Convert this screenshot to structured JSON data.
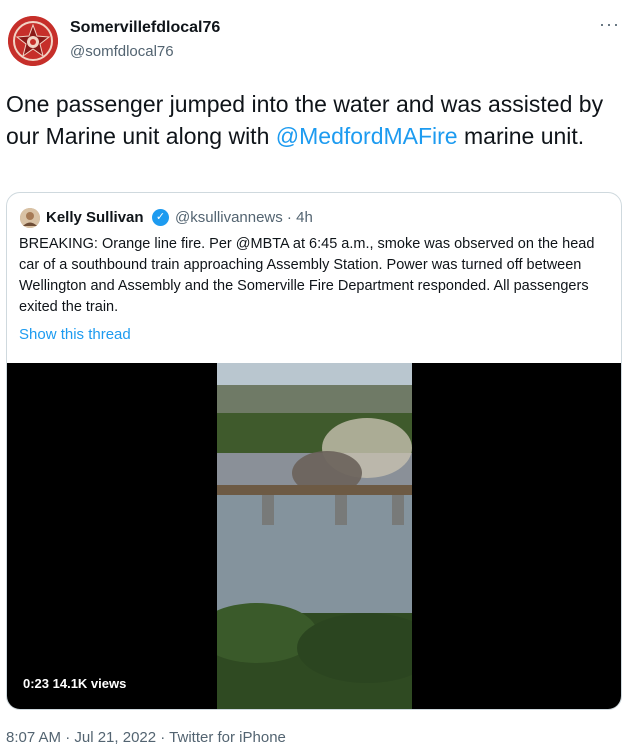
{
  "tweet": {
    "display_name": "Somervillefdlocal76",
    "handle": "@somfdlocal76",
    "more_label": "···",
    "text_before": "One passenger jumped into the water and was assisted by our Marine unit along with ",
    "mention": "@MedfordMAFire",
    "text_after": " marine unit.",
    "timestamp": "8:07 AM · Jul 21, 2022 · Twitter for iPhone"
  },
  "quoted": {
    "display_name": "Kelly Sullivan",
    "handle_time": "@ksullivannews · 4h",
    "text": "BREAKING: Orange line fire. Per @MBTA at 6:45 a.m., smoke was observed on the head car of a southbound train approaching Assembly Station.  Power was turned off between Wellington and Assembly and the Somerville Fire Department responded.  All passengers exited the train.",
    "thread_link": "Show this thread",
    "video": {
      "stats": "0:23  14.1K views"
    }
  },
  "icons": {
    "avatar": "fire-department-badge-icon",
    "verified": "verified-badge-icon",
    "more": "more-options-icon"
  },
  "colors": {
    "link": "#1d9bf0",
    "secondary_text": "#536471",
    "border": "#cfd9de"
  }
}
